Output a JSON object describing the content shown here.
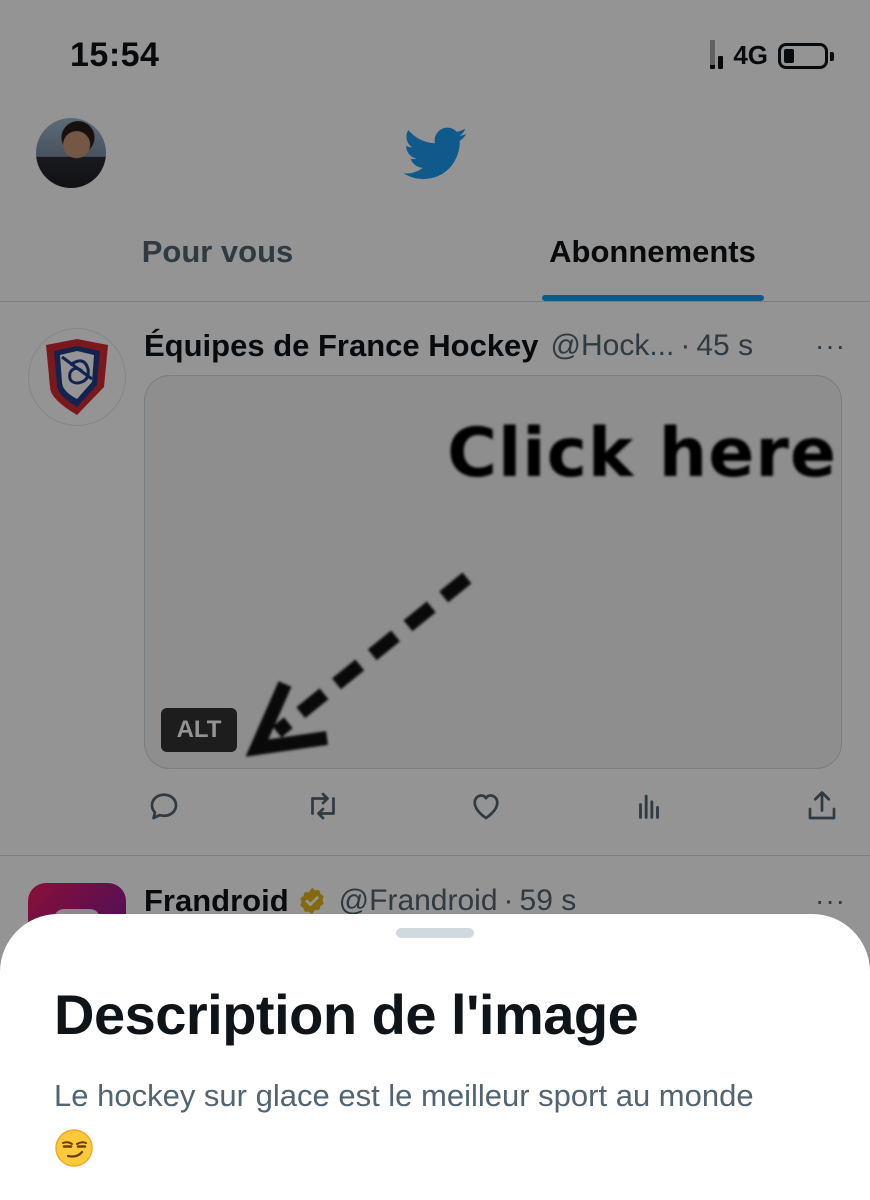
{
  "status_bar": {
    "time": "15:54",
    "network": "4G"
  },
  "header": {
    "logo_icon": "twitter-bird-icon",
    "accent_color": "#1d9bf0"
  },
  "tabs": [
    {
      "label": "Pour vous",
      "active": false
    },
    {
      "label": "Abonnements",
      "active": true
    }
  ],
  "tweets": [
    {
      "name": "Équipes de France Hockey",
      "handle": "@Hock...",
      "dot": "·",
      "time": "45 s",
      "more": "···",
      "media": {
        "text": "Click here",
        "alt_badge": "ALT"
      },
      "actions": [
        "reply-icon",
        "retweet-icon",
        "like-icon",
        "views-icon",
        "share-icon"
      ]
    },
    {
      "name": "Frandroid",
      "handle": "@Frandroid",
      "dot": "·",
      "time": "59 s",
      "more": "···",
      "verified": true
    }
  ],
  "sheet": {
    "title": "Description de l'image",
    "description": "Le hockey sur glace est le meilleur sport au monde",
    "emoji_icon": "smirking-face-icon"
  }
}
